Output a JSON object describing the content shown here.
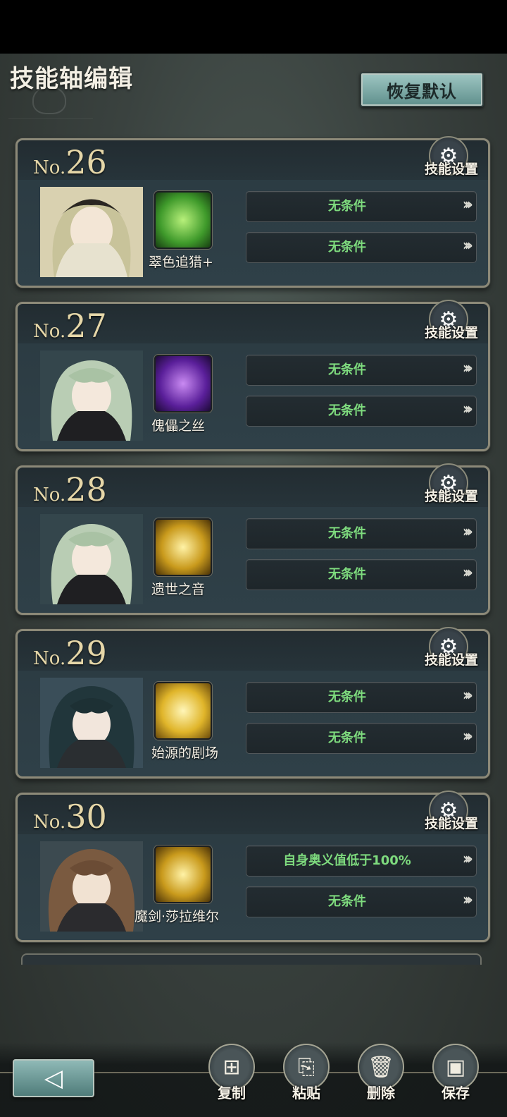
{
  "page": {
    "title": "技能轴编辑",
    "reset_label": "恢复默认"
  },
  "card_common": {
    "prefix": "No.",
    "gear_label": "技能设置",
    "arrow": "›››"
  },
  "cards": [
    {
      "number": "26",
      "skill_name": "翠色追猎+",
      "skill_color": "#4fbf3a",
      "conditions": [
        "无条件",
        "无条件"
      ]
    },
    {
      "number": "27",
      "skill_name": "傀儡之丝",
      "skill_color": "#6b2fbf",
      "conditions": [
        "无条件",
        "无条件"
      ]
    },
    {
      "number": "28",
      "skill_name": "遗世之音",
      "skill_color": "#c9a21e",
      "conditions": [
        "无条件",
        "无条件"
      ]
    },
    {
      "number": "29",
      "skill_name": "始源的剧场",
      "skill_color": "#e2c02a",
      "conditions": [
        "无条件",
        "无条件"
      ]
    },
    {
      "number": "30",
      "skill_name": "魔剑·莎拉维尔",
      "skill_color": "#c9a21e",
      "conditions": [
        "自身奥义值低于100%",
        "无条件"
      ]
    }
  ],
  "actions": [
    {
      "label": "复制",
      "icon": "copy-icon"
    },
    {
      "label": "粘贴",
      "icon": "paste-icon"
    },
    {
      "label": "删除",
      "icon": "trash-icon"
    },
    {
      "label": "保存",
      "icon": "save-icon"
    }
  ],
  "colors": {
    "condition_text": "#7edb7e",
    "number_gold": "#e6d7a8",
    "accent_teal": "#8fb9b6"
  }
}
